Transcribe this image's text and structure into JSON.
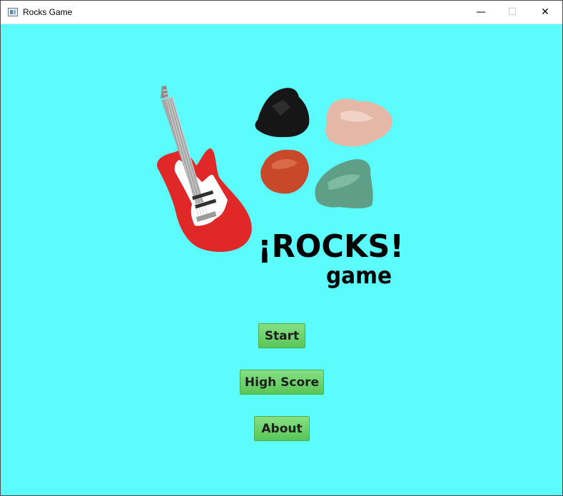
{
  "window": {
    "title": "Rocks Game",
    "controls": {
      "minimize": "—",
      "maximize": "☐",
      "close": "✕"
    },
    "background": "#5cfcfc"
  },
  "logo": {
    "title": "¡ROCKS!",
    "subtitle": "game",
    "icons": [
      "guitar-icon",
      "black-rock-icon",
      "pink-rock-icon",
      "red-rock-icon",
      "green-rock-icon"
    ]
  },
  "menu": {
    "start": "Start",
    "high_score": "High Score",
    "about": "About"
  },
  "colors": {
    "button_top": "#86e083",
    "button_bottom": "#58c657",
    "guitar_body": "#e02828"
  }
}
